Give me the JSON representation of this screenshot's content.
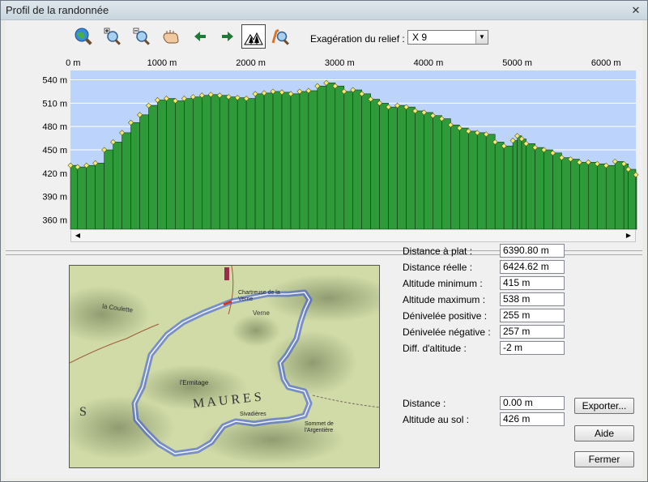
{
  "window": {
    "title": "Profil de la randonnée",
    "close_glyph": "✕"
  },
  "toolbar": {
    "buttons": [
      {
        "icon": "globe-zoom-icon"
      },
      {
        "icon": "zoom-in-icon"
      },
      {
        "icon": "zoom-out-icon"
      },
      {
        "icon": "pan-hand-icon"
      },
      {
        "icon": "arrow-left-icon"
      },
      {
        "icon": "arrow-right-icon"
      },
      {
        "icon": "forest-profile-icon",
        "pressed": true
      },
      {
        "icon": "profile-zoom-icon"
      }
    ],
    "relief_label": "Exagération du relief :",
    "relief_value": "X 9"
  },
  "chart_data": {
    "type": "bar",
    "x_unit": "m",
    "x_ticks": [
      0,
      1000,
      2000,
      3000,
      4000,
      5000,
      6000
    ],
    "x_tick_labels": [
      "0 m",
      "1000 m",
      "2000 m",
      "3000 m",
      "4000 m",
      "5000 m",
      "6000 m"
    ],
    "y_ticks": [
      360,
      390,
      420,
      450,
      480,
      510,
      540
    ],
    "y_tick_labels": [
      "360 m",
      "390 m",
      "420 m",
      "450 m",
      "480 m",
      "510 m",
      "540 m"
    ],
    "xlim": [
      -30,
      6335
    ],
    "ylim": [
      348,
      552
    ],
    "profile_points": [
      [
        -30,
        430
      ],
      [
        50,
        428
      ],
      [
        150,
        430
      ],
      [
        250,
        433
      ],
      [
        350,
        450
      ],
      [
        450,
        460
      ],
      [
        550,
        472
      ],
      [
        650,
        485
      ],
      [
        750,
        495
      ],
      [
        850,
        507
      ],
      [
        950,
        514
      ],
      [
        1050,
        516
      ],
      [
        1150,
        513
      ],
      [
        1250,
        516
      ],
      [
        1350,
        518
      ],
      [
        1450,
        520
      ],
      [
        1550,
        521
      ],
      [
        1650,
        520
      ],
      [
        1750,
        518
      ],
      [
        1850,
        517
      ],
      [
        1950,
        516
      ],
      [
        2050,
        522
      ],
      [
        2150,
        523
      ],
      [
        2250,
        525
      ],
      [
        2350,
        524
      ],
      [
        2450,
        522
      ],
      [
        2550,
        525
      ],
      [
        2650,
        526
      ],
      [
        2750,
        532
      ],
      [
        2850,
        536
      ],
      [
        2950,
        532
      ],
      [
        3050,
        525
      ],
      [
        3150,
        527
      ],
      [
        3250,
        522
      ],
      [
        3350,
        515
      ],
      [
        3450,
        510
      ],
      [
        3550,
        505
      ],
      [
        3650,
        507
      ],
      [
        3750,
        505
      ],
      [
        3850,
        500
      ],
      [
        3950,
        498
      ],
      [
        4050,
        494
      ],
      [
        4150,
        490
      ],
      [
        4250,
        482
      ],
      [
        4350,
        478
      ],
      [
        4450,
        474
      ],
      [
        4550,
        472
      ],
      [
        4650,
        470
      ],
      [
        4750,
        460
      ],
      [
        4850,
        455
      ],
      [
        4950,
        462
      ],
      [
        5000,
        468
      ],
      [
        5050,
        464
      ],
      [
        5100,
        458
      ],
      [
        5200,
        453
      ],
      [
        5300,
        450
      ],
      [
        5400,
        446
      ],
      [
        5500,
        440
      ],
      [
        5600,
        438
      ],
      [
        5700,
        434
      ],
      [
        5800,
        434
      ],
      [
        5900,
        432
      ],
      [
        6000,
        430
      ],
      [
        6100,
        435
      ],
      [
        6200,
        432
      ],
      [
        6250,
        425
      ],
      [
        6335,
        418
      ]
    ]
  },
  "stats": [
    {
      "label": "Distance à plat :",
      "value": "6390.80 m"
    },
    {
      "label": "Distance réelle :",
      "value": "6424.62 m"
    },
    {
      "label": "Altitude minimum :",
      "value": "415 m"
    },
    {
      "label": "Altitude maximum :",
      "value": "538 m"
    },
    {
      "label": "Dénivelée positive :",
      "value": "255 m"
    },
    {
      "label": "Dénivelée négative :",
      "value": "257 m"
    },
    {
      "label": "Diff. d'altitude :",
      "value": "-2 m"
    }
  ],
  "cursor": [
    {
      "label": "Distance :",
      "value": "0.00 m"
    },
    {
      "label": "Altitude au sol :",
      "value": "426 m"
    }
  ],
  "buttons": {
    "export": "Exporter...",
    "help": "Aide",
    "close": "Fermer"
  },
  "map": {
    "labels": {
      "coulette": "la Coulette",
      "verne": "Verne",
      "chartreuse": "Chartreuse de la Verne",
      "ermitage": "l'Ermitage",
      "maures_s": "S",
      "maures": "M A U R E S",
      "sonnet": "Sommet de l'Argentière",
      "siv": "Sivadières"
    }
  },
  "colors": {
    "plot_bg": "#bcd4fb",
    "bar_fill": "#2f9a3a",
    "bar_stroke": "#0d3b10",
    "point": "#f2ea7a",
    "track": "#3a64f0"
  }
}
